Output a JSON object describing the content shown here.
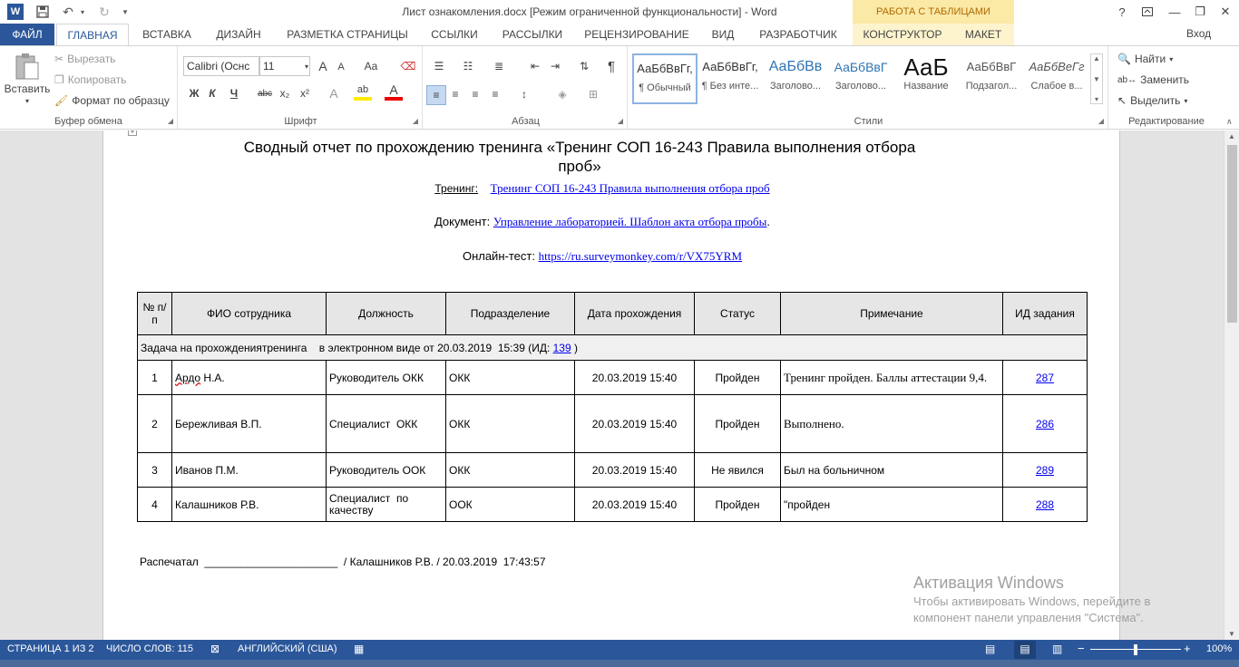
{
  "titlebar": {
    "app_icon": "word-icon",
    "title": "Лист ознакомления.docx [Режим ограниченной функциональности] - Word",
    "context_header": "РАБОТА С ТАБЛИЦАМИ",
    "help": "?"
  },
  "tabs": [
    {
      "label": "ФАЙЛ"
    },
    {
      "label": "ГЛАВНАЯ"
    },
    {
      "label": "ВСТАВКА"
    },
    {
      "label": "ДИЗАЙН"
    },
    {
      "label": "РАЗМЕТКА СТРАНИЦЫ"
    },
    {
      "label": "ССЫЛКИ"
    },
    {
      "label": "РАССЫЛКИ"
    },
    {
      "label": "РЕЦЕНЗИРОВАНИЕ"
    },
    {
      "label": "ВИД"
    },
    {
      "label": "РАЗРАБОТЧИК"
    },
    {
      "label": "КОНСТРУКТОР"
    },
    {
      "label": "МАКЕТ"
    }
  ],
  "signin": "Вход",
  "ribbon": {
    "clipboard": {
      "label": "Буфер обмена",
      "paste": "Вставить",
      "cut": "Вырезать",
      "copy": "Копировать",
      "format_painter": "Формат по образцу"
    },
    "font": {
      "label": "Шрифт",
      "family": "Calibri (Оснс",
      "size": "11",
      "grow": "A",
      "shrink": "A",
      "case": "Aa",
      "bold": "Ж",
      "italic": "К",
      "underline": "Ч",
      "strike": "abc",
      "subscript": "x₂",
      "superscript": "x²",
      "effects": "A",
      "highlight": "ab",
      "color": "A"
    },
    "paragraph": {
      "label": "Абзац",
      "pilcrow": "¶"
    },
    "styles": {
      "label": "Стили",
      "items": [
        {
          "preview": "АаБбВвГг,",
          "name": "¶ Обычный"
        },
        {
          "preview": "АаБбВвГг,",
          "name": "¶ Без инте..."
        },
        {
          "preview": "АаБбВв",
          "name": "Заголово..."
        },
        {
          "preview": "АаБбВвГ",
          "name": "Заголово..."
        },
        {
          "preview": "АаБ",
          "name": "Название"
        },
        {
          "preview": "АаБбВвГ",
          "name": "Подзагол..."
        },
        {
          "preview": "АаБбВеГг",
          "name": "Слабое в..."
        }
      ]
    },
    "editing": {
      "label": "Редактирование",
      "find": "Найти",
      "replace": "Заменить",
      "select": "Выделить"
    }
  },
  "document": {
    "title": "Сводный отчет по прохождению тренинга «Тренинг СОП 16-243 Правила выполнения отбора",
    "title_line2": "проб»",
    "training_label": "Тренинг:",
    "training_link": "Тренинг СОП 16-243 Правила выполнения отбора проб",
    "document_label": "Документ:",
    "document_link": "Управление лабораторией. Шаблон акта отбора пробы",
    "document_period": ".",
    "test_label": "Онлайн-тест:",
    "test_link": "https://ru.surveymonkey.com/r/VX75YRM",
    "table": {
      "headers": [
        "№ п/п",
        "ФИО сотрудника",
        "Должность",
        "Подразделение",
        "Дата прохождения",
        "Статус",
        "Примечание",
        "ИД задания"
      ],
      "task_row_text": "Задача на прохождениятренинга    в электронном виде от 20.03.2019  15:39 (ИД: ",
      "task_row_id": "139",
      "task_row_end": " )",
      "rows": [
        {
          "num": "1",
          "name_a": "Ардо",
          "name_b": " Н.А.",
          "position": "Руководитель ОКК",
          "unit": "ОКК",
          "date": "20.03.2019  15:40",
          "status": "Пройден",
          "note": "Тренинг пройден. Баллы аттестации 9,4.",
          "id": "287"
        },
        {
          "num": "2",
          "name_a": "",
          "name_b": "Бережливая В.П.",
          "position": "Специалист  ОКК",
          "unit": "ОКК",
          "date": "20.03.2019  15:40",
          "status": "Пройден",
          "note": "Выполнено.",
          "id": "286"
        },
        {
          "num": "3",
          "name_a": "",
          "name_b": "Иванов П.М.",
          "position": "Руководитель ООК",
          "unit": "ОКК",
          "date": "20.03.2019  15:40",
          "status": "Не явился",
          "note": "Был на больничном",
          "id": "289"
        },
        {
          "num": "4",
          "name_a": "",
          "name_b": "Калашников Р.В.",
          "position": "Специалист  по качеству",
          "unit": "ООК",
          "date": "20.03.2019  15:40",
          "status": "Пройден",
          "note": "\"пройден",
          "id": "288"
        }
      ]
    },
    "printed": "Распечатал  ______________________  / Калашников Р.В. / 20.03.2019  17:43:57"
  },
  "activation": {
    "title": "Активация Windows",
    "line1": "Чтобы активировать Windows, перейдите в",
    "line2": "компонент панели управления \"Система\"."
  },
  "statusbar": {
    "page": "СТРАНИЦА 1 ИЗ 2",
    "words": "ЧИСЛО СЛОВ: 115",
    "language": "АНГЛИЙСКИЙ (США)",
    "zoom": "100%"
  }
}
